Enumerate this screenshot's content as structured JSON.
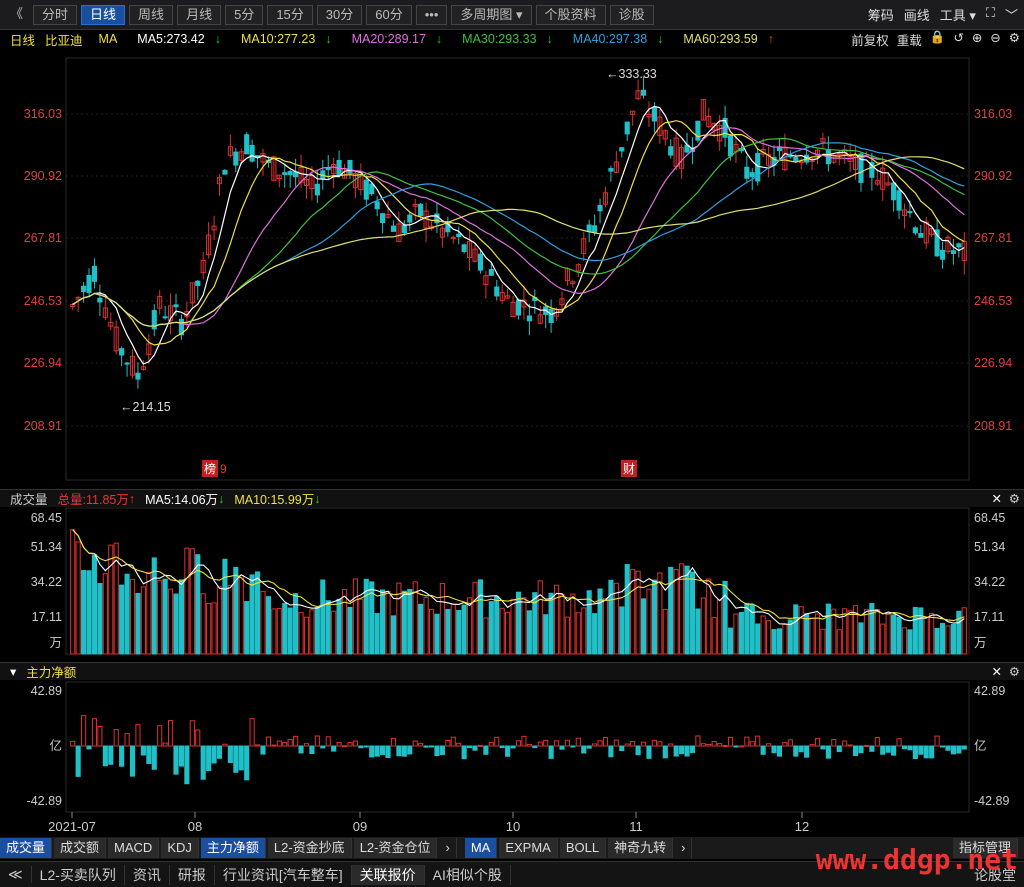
{
  "toolbar": {
    "back_icon": "《",
    "period_tabs": [
      "分时",
      "日线",
      "周线",
      "月线",
      "5分",
      "15分",
      "30分",
      "60分"
    ],
    "active_period": "日线",
    "more_label": "•••",
    "multi_period_label": "多周期图",
    "stock_info_label": "个股资料",
    "diagnose_label": "诊股",
    "right_tools": [
      "筹码",
      "画线",
      "工具"
    ]
  },
  "ma_bar": {
    "period": "日线",
    "stock_name": "比亚迪",
    "ma_label": "MA",
    "ma5": "MA5:273.42",
    "ma10": "MA10:277.23",
    "ma20": "MA20:289.17",
    "ma30": "MA30:293.33",
    "ma40": "MA40:297.38",
    "ma60": "MA60:293.59",
    "arrows": [
      "↓",
      "↓",
      "↓",
      "↓",
      "↓",
      "↑"
    ],
    "fq_label": "前复权",
    "reset_label": "重载"
  },
  "colors": {
    "ma5": "#ffffff",
    "ma10": "#f0e040",
    "ma20": "#e070e0",
    "ma30": "#40c040",
    "ma40": "#30a0e0",
    "ma60": "#e0e070",
    "up": "#e03030",
    "down": "#20c0c8",
    "axis_text": "#e04040"
  },
  "price_axis": [
    "316.03",
    "290.92",
    "267.81",
    "246.53",
    "226.94",
    "208.91"
  ],
  "annotations": {
    "high": "←333.33",
    "low": "←214.15",
    "tag1": "榜",
    "tag1b": "9",
    "tag2": "财"
  },
  "volume": {
    "title": "成交量",
    "total": "总量:11.85万",
    "ma5": "MA5:14.06万",
    "ma10": "MA10:15.99万",
    "axis": [
      "68.45",
      "51.34",
      "34.22",
      "17.11",
      "万"
    ]
  },
  "flow": {
    "title": "主力净额",
    "axis": [
      "42.89",
      "亿",
      "-42.89"
    ]
  },
  "months": [
    "2021-07",
    "08",
    "09",
    "10",
    "11",
    "12"
  ],
  "indicator_tabs_left": [
    "成交量",
    "成交额",
    "MACD",
    "KDJ",
    "主力净额",
    "L2-资金抄底",
    "L2-资金仓位"
  ],
  "indicator_tabs_right": [
    "MA",
    "EXPMA",
    "BOLL",
    "神奇九转"
  ],
  "indicator_manage": "指标管理",
  "footer_tabs": [
    "L2-买卖队列",
    "资讯",
    "研报",
    "行业资讯[汽车整车]",
    "关联报价",
    "AI相似个股"
  ],
  "footer_active": "关联报价",
  "footer_last": "论股堂",
  "watermark": "www.ddgp.net"
}
